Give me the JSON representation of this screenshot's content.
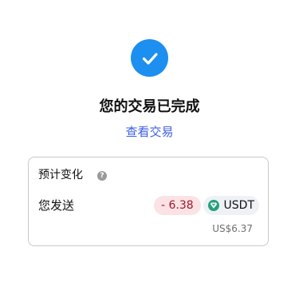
{
  "status": {
    "icon": "check-circle-icon",
    "title": "您的交易已完成",
    "link_label": "查看交易"
  },
  "summary": {
    "label": "预计变化",
    "help_icon": "question-icon",
    "help_glyph": "?",
    "send_label": "您发送",
    "amount": "- 6.38",
    "token": "USDT",
    "token_icon": "tether-icon",
    "usd_value": "US$6.37"
  },
  "colors": {
    "accent": "#1c8ff0",
    "link": "#3b5ee8",
    "negative_text": "#a2172a",
    "negative_bg": "#fbe3e5",
    "token_green": "#26a17b"
  }
}
